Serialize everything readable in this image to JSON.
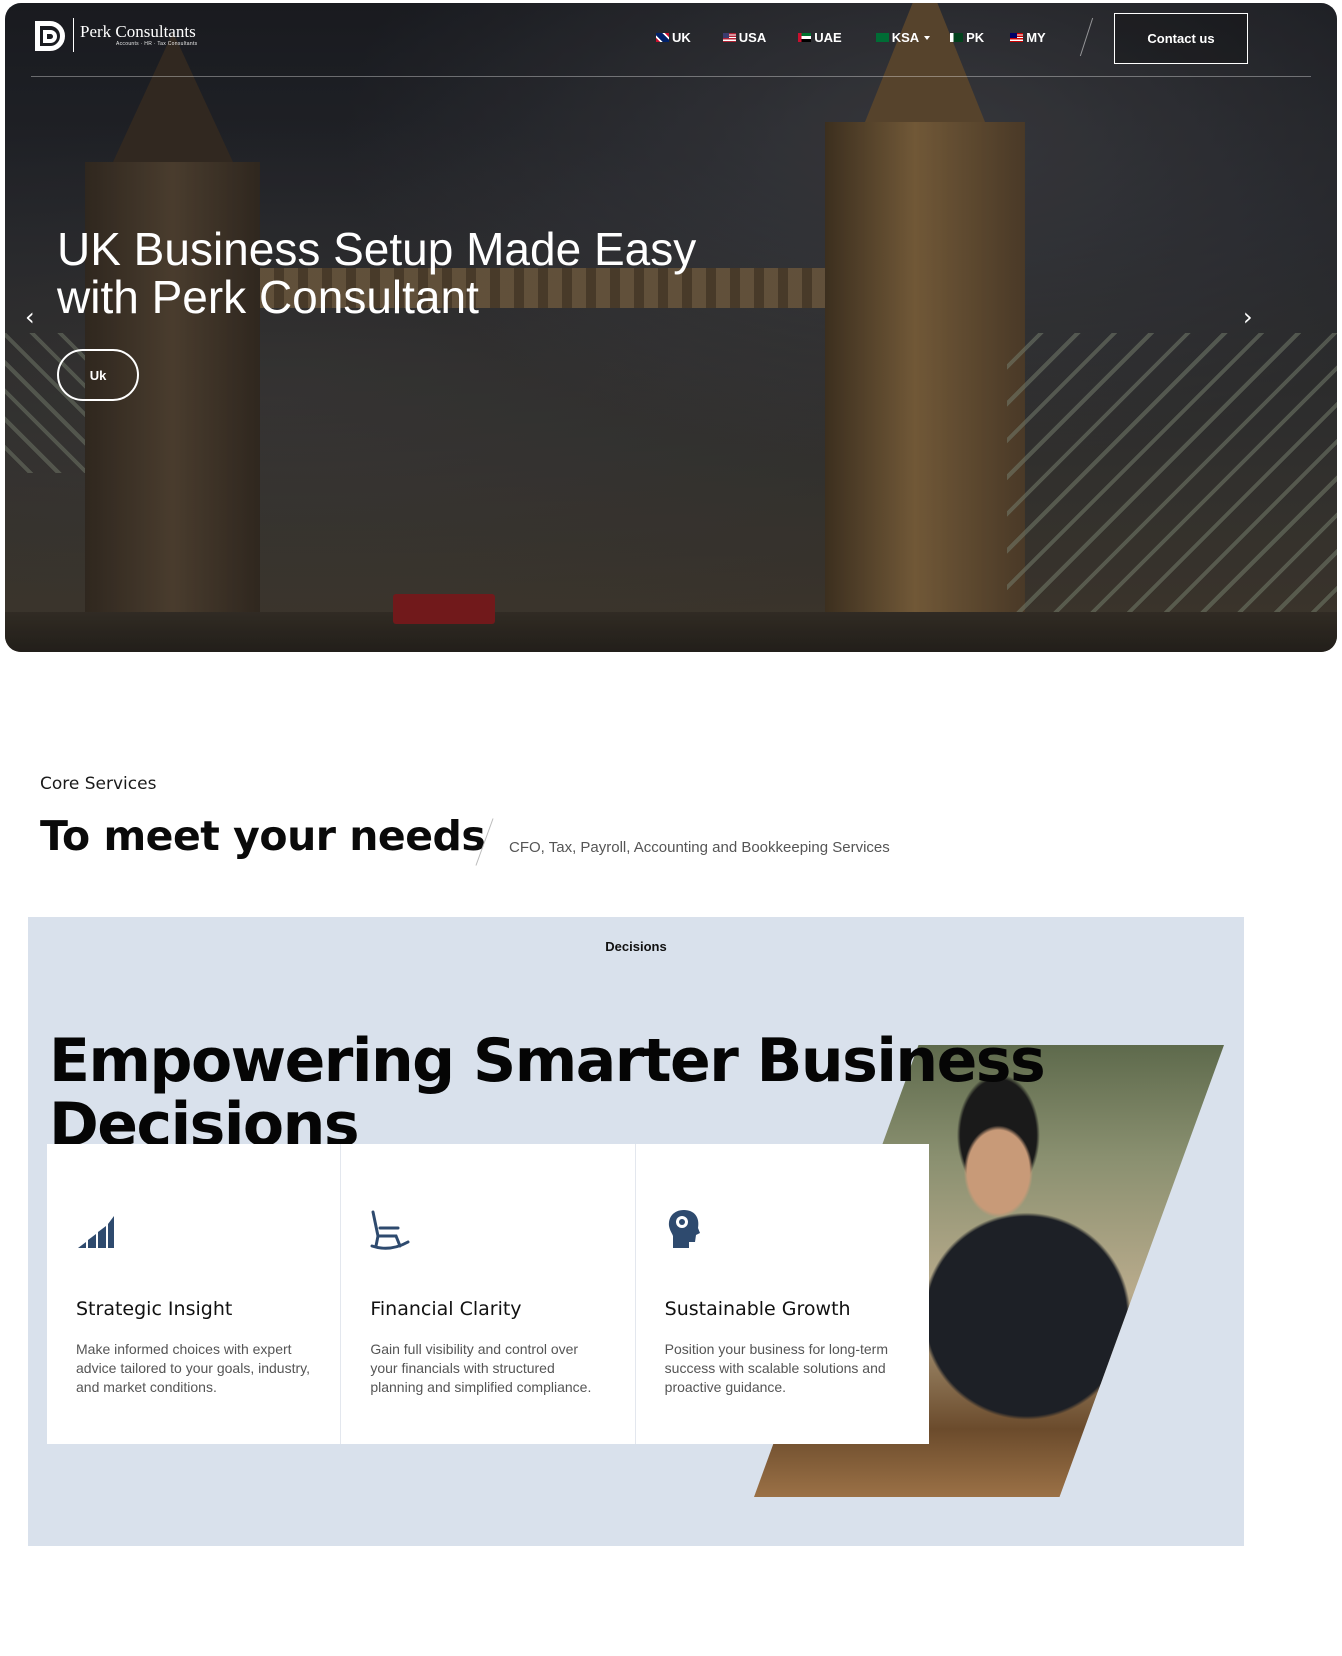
{
  "header": {
    "logo_name": "Perk Consultants",
    "logo_tagline": "Accounts · HR · Tax Consultants",
    "countries": [
      {
        "code": "UK",
        "flag": "uk-flag-icon"
      },
      {
        "code": "USA",
        "flag": "usa-flag-icon"
      },
      {
        "code": "UAE",
        "flag": "uae-flag-icon"
      },
      {
        "code": "KSA",
        "flag": "ksa-flag-icon",
        "has_dropdown": true
      },
      {
        "code": "PK",
        "flag": "pk-flag-icon"
      },
      {
        "code": "MY",
        "flag": "my-flag-icon"
      }
    ],
    "contact_label": "Contact us"
  },
  "hero": {
    "title_line1": "UK Business Setup Made Easy",
    "title_line2": "with Perk Consultant",
    "pill_label": "Uk",
    "prev_icon": "chevron-left-icon",
    "next_icon": "chevron-right-icon"
  },
  "services": {
    "label": "Core Services",
    "title": "To meet your needs",
    "subtitle": "CFO, Tax, Payroll, Accounting and Bookkeeping Services"
  },
  "decisions": {
    "tag": "Decisions",
    "title": "Empowering Smarter Business Decisions",
    "accent_color": "#2e4a6e",
    "panel_bg": "#d9e1ec",
    "cards": [
      {
        "icon": "signal-bars-icon",
        "title": "Strategic Insight",
        "text": "Make informed choices with expert advice tailored to your goals, industry, and market conditions."
      },
      {
        "icon": "rocking-chair-icon",
        "title": "Financial Clarity",
        "text": "Gain full visibility and control over your financials with structured planning and simplified compliance."
      },
      {
        "icon": "head-brain-icon",
        "title": "Sustainable Growth",
        "text": "Position your business for long-term success with scalable solutions and proactive guidance."
      }
    ]
  }
}
